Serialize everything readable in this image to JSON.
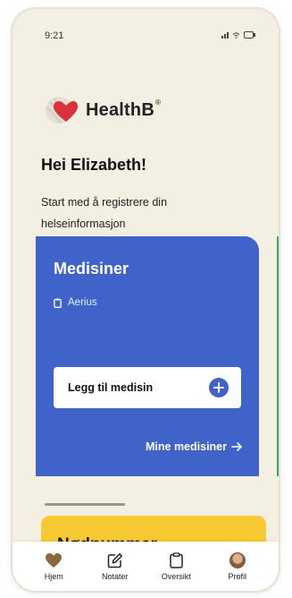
{
  "status_bar": {
    "time": "9:21"
  },
  "logo": {
    "name": "HealthB",
    "reg_mark": "®"
  },
  "greeting": "Hei Elizabeth!",
  "subtitle": "Start med å registrere din helseinformasjon",
  "medicines_card": {
    "title": "Medisiner",
    "items": [
      "Aerius"
    ],
    "add_button_label": "Legg til medisin",
    "my_medicines_link": "Mine medisiner"
  },
  "emergency_card": {
    "title": "Nødnummer"
  },
  "tab_bar": {
    "items": [
      {
        "label": "Hjem",
        "icon": "heart-icon"
      },
      {
        "label": "Notater",
        "icon": "edit-note-icon"
      },
      {
        "label": "Oversikt",
        "icon": "clipboard-icon"
      },
      {
        "label": "Profil",
        "icon": "avatar"
      }
    ]
  },
  "colors": {
    "background": "#f3efe3",
    "medicines_card": "#3f63c8",
    "emergency_card": "#f8c932",
    "next_card_peek": "#3ca55c",
    "heart": "#d9323f",
    "tab_heart": "#8a6a3a"
  }
}
